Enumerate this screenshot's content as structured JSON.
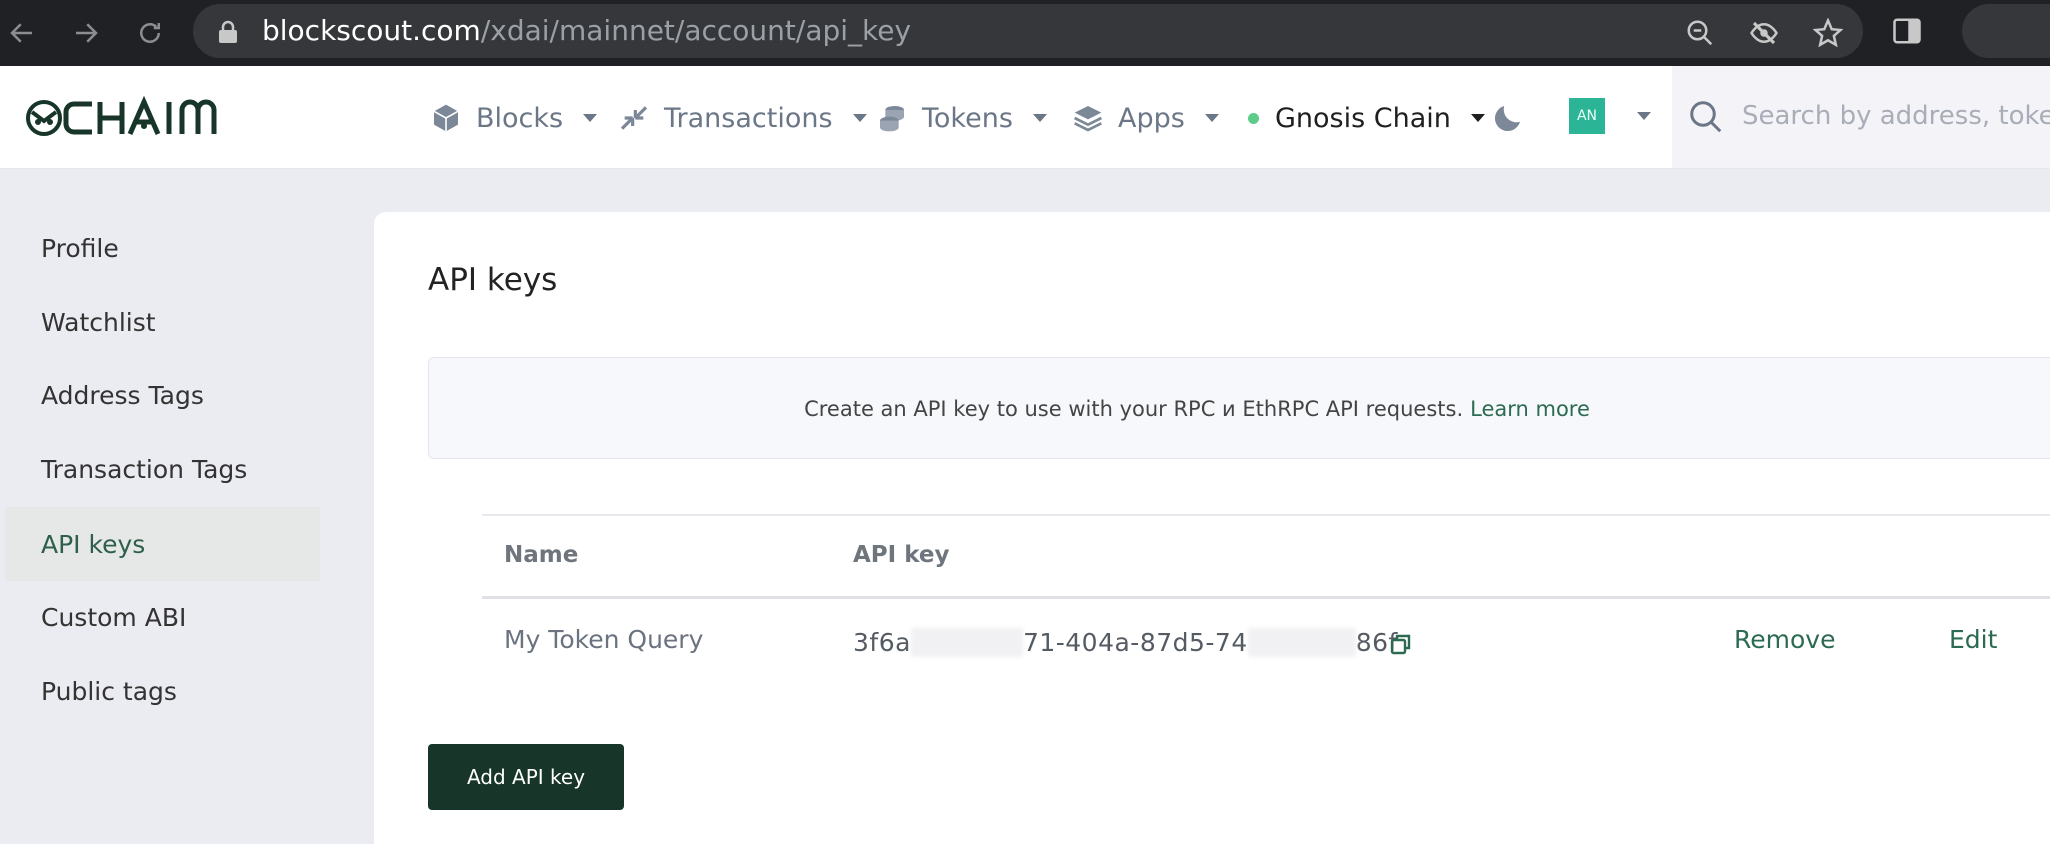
{
  "browser": {
    "url_host": "blockscout.com",
    "url_path": "/xdai/mainnet/account/api_key"
  },
  "header": {
    "menu": [
      {
        "label": "Blocks",
        "icon": "cube-icon"
      },
      {
        "label": "Transactions",
        "icon": "arrows-icon"
      },
      {
        "label": "Tokens",
        "icon": "coins-icon"
      },
      {
        "label": "Apps",
        "icon": "layers-icon"
      }
    ],
    "network": "Gnosis Chain",
    "avatar_initials": "AN",
    "search_placeholder": "Search by address, token symbol"
  },
  "sidebar": {
    "items": [
      {
        "label": "Profile"
      },
      {
        "label": "Watchlist"
      },
      {
        "label": "Address Tags"
      },
      {
        "label": "Transaction Tags"
      },
      {
        "label": "API keys"
      },
      {
        "label": "Custom ABI"
      },
      {
        "label": "Public tags"
      }
    ],
    "active": "API keys"
  },
  "main": {
    "title": "API keys",
    "info_text": "Create an API key to use with your RPC и EthRPC API requests.",
    "learn_more": "Learn more",
    "table": {
      "headers": {
        "name": "Name",
        "key": "API key"
      },
      "rows": [
        {
          "name": "My Token Query",
          "key_start": "3f6a",
          "key_middle": "71-404a-87d5-74",
          "key_end": "86f",
          "remove": "Remove",
          "edit": "Edit"
        }
      ]
    },
    "add_button": "Add API key"
  },
  "colors": {
    "accent": "#2c6a52",
    "button_bg": "#173528",
    "active_sidebar_bg": "#e5e8e7",
    "avatar_bg": "#2bb596",
    "status_dot": "#5ccc8a"
  }
}
